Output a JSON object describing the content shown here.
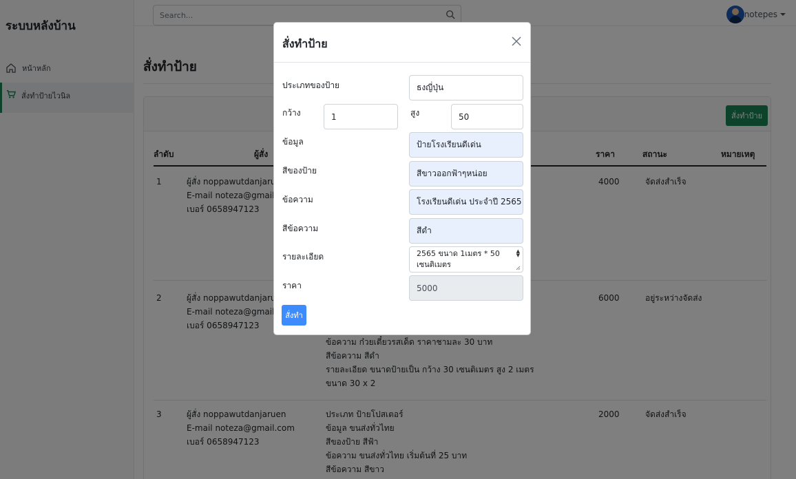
{
  "app": {
    "brand": "ระบบหลังบ้าน"
  },
  "sidebar": {
    "items": [
      {
        "label": "หน้าหลัก",
        "icon": "home-icon"
      },
      {
        "label": "สั่งทำป้ายไวนิล",
        "icon": "cart-icon"
      }
    ]
  },
  "topbar": {
    "search_placeholder": "Search...",
    "user_name": "notepes"
  },
  "main": {
    "title": "สั่งทำป้าย",
    "order_button": "สั่งทำป้าย",
    "columns": [
      "ลำดับ",
      "ผู้สั่ง",
      "ราคา",
      "สถานะ",
      "หมายเหตุ"
    ],
    "rows": [
      {
        "no": "1",
        "customer": [
          "ผู้สั่ง noppawutdanjaru",
          "E-mail noteza@gmail",
          "เบอร์ 0658947123"
        ],
        "details": [],
        "price": "4000",
        "status": "จัดส่งสำเร็จ"
      },
      {
        "no": "2",
        "customer": [
          "ผู้สั่ง noppawutdanjaru",
          "E-mail noteza@gmail",
          "เบอร์ 0658947123"
        ],
        "details": [
          "ข้อความ ก๋วยเตี๋ยวรสเด็ด ราคาชามละ 30 บาท",
          "สีข้อความ สีดำ",
          "รายละเอียด ขนาดป้ายเป็น กว้าง 30 เซนติเมตร สูง 2 เมตร",
          "ขนาด 30 x 2"
        ],
        "price": "6000",
        "status": "อยู่ระหว่างจัดส่ง"
      },
      {
        "no": "3",
        "customer": [
          "ผู้สั่ง noppawutdanjaruen",
          "E-mail noteza@gmail.com",
          "เบอร์ 0658947123"
        ],
        "details": [
          "ประเภท ป้ายโปสเตอร์",
          "ข้อมูล ขนส่งทั่วไทย",
          "สีของป้าย สีฟ้า",
          "ข้อความ ขนส่งทั่วไทย เริ่มต้นที่ 25 บาท",
          "สีข้อความ สีขาว"
        ],
        "price": "2000",
        "status": "จัดส่งสำเร็จ"
      }
    ]
  },
  "modal": {
    "title": "สั่งทำป้าย",
    "labels": {
      "type": "ประเภทของป้าย",
      "width": "กว้าง",
      "height": "สูง",
      "info": "ข้อมูล",
      "sign_color": "สีของป้าย",
      "text": "ข้อความ",
      "text_color": "สีข้อความ",
      "detail": "รายละเอียด",
      "price": "ราคา"
    },
    "values": {
      "type": "ธงญี่ปุ่น",
      "width": "1",
      "height": "50",
      "info": "ป้ายโรงเรียนดีเด่น",
      "sign_color": "สีขาวออกฟ้าๆหน่อย",
      "text": "โรงเรียนดีเด่น ประจำปี 2565",
      "text_color": "สีดำ",
      "detail_line1": "2565 ขนาด 1เมตร * 50",
      "detail_line2": "เซนติเมตร",
      "price": "5000"
    },
    "submit": "สั่งทำ"
  },
  "colors": {
    "primary": "#3d8bfd",
    "success": "#198754",
    "autofill": "#e8f0fe"
  }
}
